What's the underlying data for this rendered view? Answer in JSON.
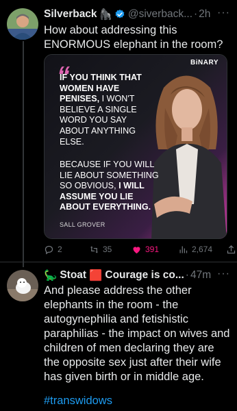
{
  "tweet1": {
    "display_name": "Silverback",
    "name_emoji": "🦍",
    "handle": "@siverback...",
    "separator": "·",
    "time": "2h",
    "more": "···",
    "text": "How about addressing this ENORMOUS elephant in the room?",
    "card": {
      "brand": "BiNARY",
      "quote_open": "“",
      "quote_close": "”",
      "quote_part1_bold": "If you think that women have penises,",
      "quote_part1_light": "I won't believe a single word you say about anything else.",
      "quote_part2_light": "Because if you will lie about something so obvious,",
      "quote_part2_bold": "I will assume you lie about everything.",
      "author": "SALL GROVER"
    },
    "actions": {
      "replies": "2",
      "retweets": "35",
      "likes": "391",
      "views": "2,674"
    },
    "verified_color": "#1d9bf0",
    "like_color": "#f91880"
  },
  "tweet2": {
    "name_emoji": "🦕",
    "display_name": "Stoat",
    "flag_emoji": "🟥",
    "name_suffix": "Courage is co...",
    "separator": "·",
    "time": "47m",
    "more": "···",
    "text": "And please address the other elephants in the room - the autogynephilia and fetishistic paraphilias - the impact on wives and children of men declaring they are the opposite sex just after their wife has given birth or in middle age.",
    "hashtag": "#transwidows"
  }
}
